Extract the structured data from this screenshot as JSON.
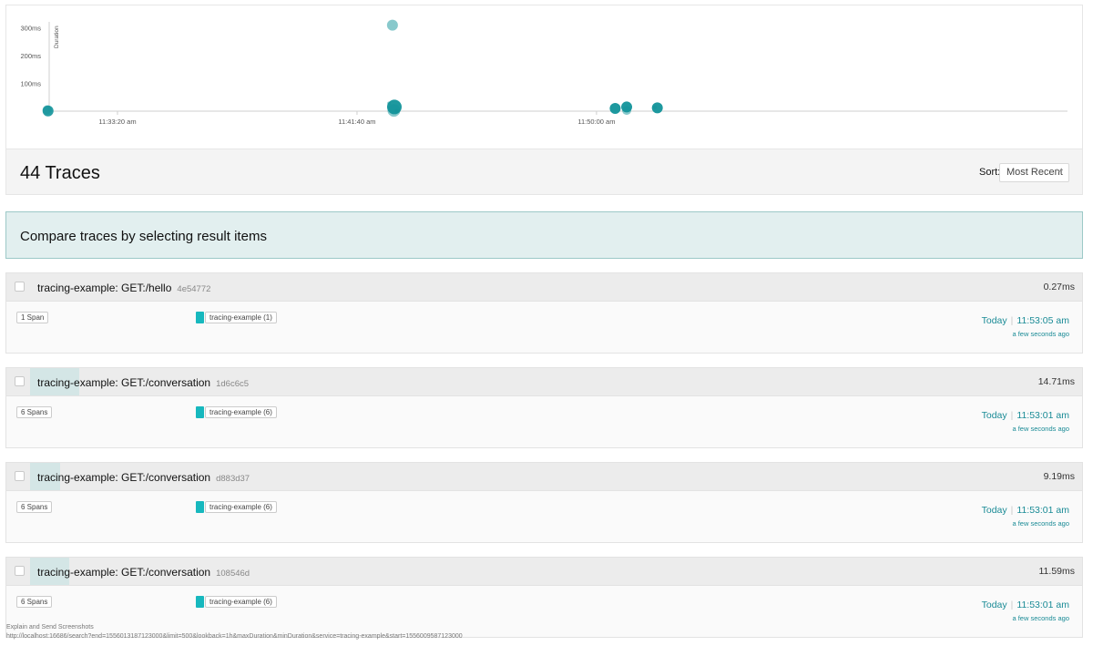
{
  "chart_data": {
    "type": "scatter",
    "title": "",
    "ylabel": "Duration",
    "xlabel": "",
    "y_ticks": [
      "100ms",
      "200ms",
      "300ms"
    ],
    "x_ticks": [
      "11:33:20 am",
      "11:41:40 am",
      "11:50:00 am"
    ],
    "ylim": [
      0,
      330
    ],
    "xlim_seconds_from_first_tick": [
      -150,
      1130
    ],
    "point_color": "#12939a",
    "points": [
      {
        "t": -147,
        "duration": 5,
        "size": 5,
        "opacity": 0.45
      },
      {
        "t": -145,
        "duration": 1,
        "size": 6,
        "opacity": 0.9
      },
      {
        "t": 574,
        "duration": 310,
        "size": 6,
        "opacity": 0.5
      },
      {
        "t": 567,
        "duration": 28,
        "size": 2,
        "opacity": 0.5
      },
      {
        "t": 577,
        "duration": 3,
        "size": 7,
        "opacity": 0.5
      },
      {
        "t": 578,
        "duration": 15,
        "size": 8,
        "opacity": 0.95
      },
      {
        "t": 583,
        "duration": 1,
        "size": 2,
        "opacity": 0.6
      },
      {
        "t": 1039,
        "duration": 10,
        "size": 6,
        "opacity": 0.95
      },
      {
        "t": 1063,
        "duration": 3,
        "size": 5,
        "opacity": 0.5
      },
      {
        "t": 1063,
        "duration": 15,
        "size": 6,
        "opacity": 0.95
      },
      {
        "t": 1122,
        "duration": 14,
        "size": 2,
        "opacity": 0.6
      },
      {
        "t": 1127,
        "duration": 12,
        "size": 6,
        "opacity": 0.95
      }
    ]
  },
  "results": {
    "count_label": "44 Traces",
    "sort_label": "Sort:",
    "sort_value": "Most Recent",
    "sort_icon": "chevron-down-icon"
  },
  "compare_banner": "Compare traces by selecting result items",
  "traces": [
    {
      "title": "tracing-example: GET:/hello",
      "id": "4e54772",
      "duration": "0.27ms",
      "duration_fraction": 0.0,
      "spans": "1 Span",
      "service": "tracing-example (1)",
      "date": "Today",
      "time": "11:53:05 am",
      "relative": "a few seconds ago"
    },
    {
      "title": "tracing-example: GET:/conversation",
      "id": "1d6c6c5",
      "duration": "14.71ms",
      "duration_fraction": 0.047,
      "spans": "6 Spans",
      "service": "tracing-example (6)",
      "date": "Today",
      "time": "11:53:01 am",
      "relative": "a few seconds ago"
    },
    {
      "title": "tracing-example: GET:/conversation",
      "id": "d883d37",
      "duration": "9.19ms",
      "duration_fraction": 0.029,
      "spans": "6 Spans",
      "service": "tracing-example (6)",
      "date": "Today",
      "time": "11:53:01 am",
      "relative": "a few seconds ago"
    },
    {
      "title": "tracing-example: GET:/conversation",
      "id": "108546d",
      "duration": "11.59ms",
      "duration_fraction": 0.037,
      "spans": "6 Spans",
      "service": "tracing-example (6)",
      "date": "Today",
      "time": "11:53:01 am",
      "relative": "a few seconds ago"
    }
  ],
  "status_bar": {
    "line1": "Explain and Send Screenshots",
    "line2": "http://localhost:16686/search?end=1556013187123000&limit=500&lookback=1h&maxDuration&minDuration&service=tracing-example&start=1556009587123000"
  }
}
